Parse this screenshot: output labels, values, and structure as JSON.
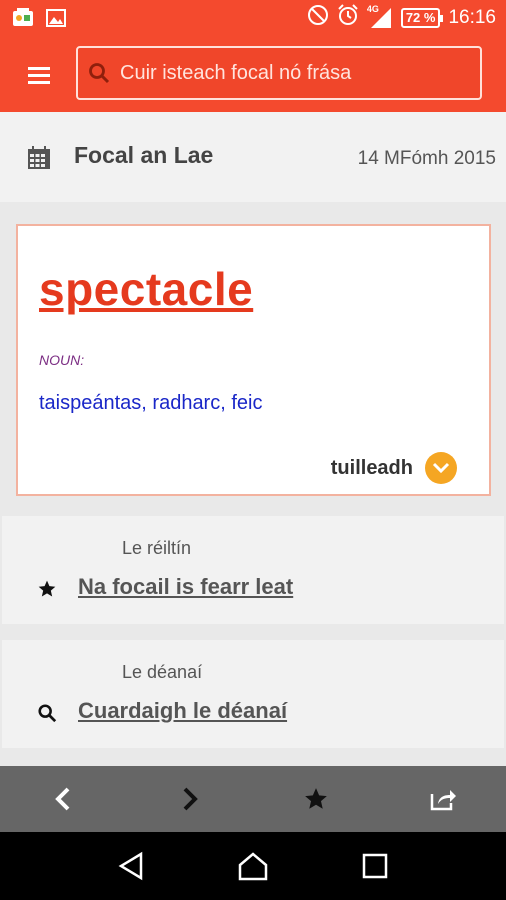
{
  "status_bar": {
    "network": "4G",
    "battery": "72 %",
    "time": "16:16"
  },
  "search": {
    "placeholder": "Cuir isteach focal nó frása"
  },
  "word_of_day": {
    "title": "Focal an Lae",
    "date": "14 MFómh 2015"
  },
  "card": {
    "word": "spectacle",
    "part_of_speech": "NOUN:",
    "translations": "taispeántas, radharc, feic",
    "more_label": "tuilleadh"
  },
  "favorites": {
    "label": "Le réiltín",
    "link": "Na focail is fearr leat"
  },
  "recent": {
    "label": "Le déanaí",
    "link": "Cuardaigh le déanaí"
  },
  "colors": {
    "accent": "#f44a2e",
    "word": "#e53a1e",
    "translation": "#1a27c8",
    "more_badge": "#f5a623"
  }
}
